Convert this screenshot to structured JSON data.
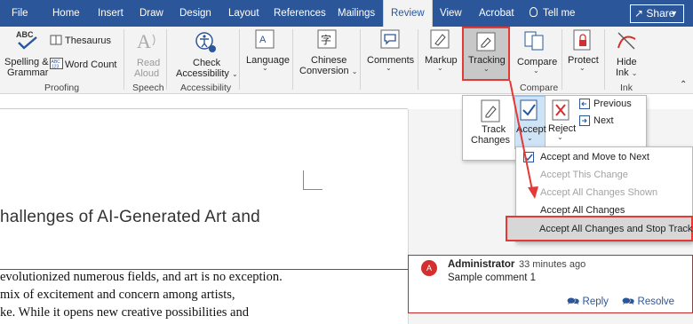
{
  "tabs": [
    "File",
    "Home",
    "Insert",
    "Draw",
    "Design",
    "Layout",
    "References",
    "Mailings",
    "Review",
    "View",
    "Acrobat"
  ],
  "active_tab": "Review",
  "tell_me": "Tell me",
  "share": "Share",
  "ribbon": {
    "spelling": "Spelling &",
    "spelling2": "Grammar",
    "thesaurus": "Thesaurus",
    "word_count": "Word Count",
    "proofing": "Proofing",
    "read_aloud": "Read",
    "read_aloud2": "Aloud",
    "speech": "Speech",
    "check_acc": "Check",
    "check_acc2": "Accessibility",
    "accessibility": "Accessibility",
    "language": "Language",
    "chinese": "Chinese",
    "chinese2": "Conversion",
    "comments": "Comments",
    "markup": "Markup",
    "tracking": "Tracking",
    "compare": "Compare",
    "compare_grp": "Compare",
    "protect": "Protect",
    "hide_ink": "Hide",
    "hide_ink2": "Ink",
    "ink": "Ink"
  },
  "tracking_panel": {
    "track_changes": "Track",
    "track_changes2": "Changes",
    "accept": "Accept",
    "reject": "Reject",
    "previous": "Previous",
    "next": "Next"
  },
  "accept_menu": {
    "items": [
      {
        "label": "Accept and Move to Next",
        "enabled": true
      },
      {
        "label": "Accept This Change",
        "enabled": false
      },
      {
        "label": "Accept All Changes Shown",
        "enabled": false
      },
      {
        "label": "Accept All Changes",
        "enabled": true
      },
      {
        "label": "Accept All Changes and Stop Tracking",
        "enabled": true
      }
    ]
  },
  "document": {
    "title": "hallenges of AI-Generated Art and",
    "lines": [
      "evolutionized numerous fields, and art is no exception.",
      "mix of excitement and concern among artists,",
      "ke. While it opens new creative possibilities and"
    ]
  },
  "comment": {
    "avatar": "A",
    "author": "Administrator",
    "time": "33 minutes ago",
    "text": "Sample comment 1",
    "reply": "Reply",
    "resolve": "Resolve"
  },
  "colors": {
    "ribbon_blue": "#2b579a",
    "highlight_red": "#e53935"
  }
}
